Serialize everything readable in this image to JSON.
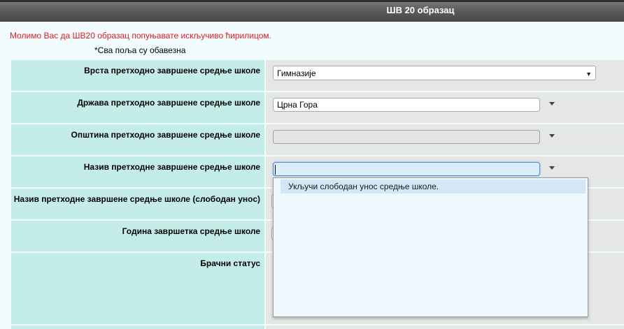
{
  "header": {
    "title": "ШВ 20 образац"
  },
  "notice": "Молимо Вас да ШВ20 образац попуњавате искључиво ћирилицом.",
  "required_note": "*Сва поља су обавезна",
  "rows": [
    {
      "label": "Врста претходно завршене средње школе",
      "value": "Гимназије"
    },
    {
      "label": "Држава претходно завршене средње школе",
      "value": "Црна Гора"
    },
    {
      "label": "Општина претходно завршене средње школе",
      "value": ""
    },
    {
      "label": "Назив претходне завршене средње школе",
      "value": ""
    },
    {
      "label": "Назив претходне завршене средње школе (слободан унос)",
      "value": ""
    },
    {
      "label": "Година завршетка средње школе",
      "value": ""
    },
    {
      "label": "Брачни статус",
      "value": ""
    }
  ],
  "dropdown": {
    "items": [
      "Укључи слободан унос средње школе."
    ]
  },
  "icons": {
    "select_arrow": "▼"
  }
}
